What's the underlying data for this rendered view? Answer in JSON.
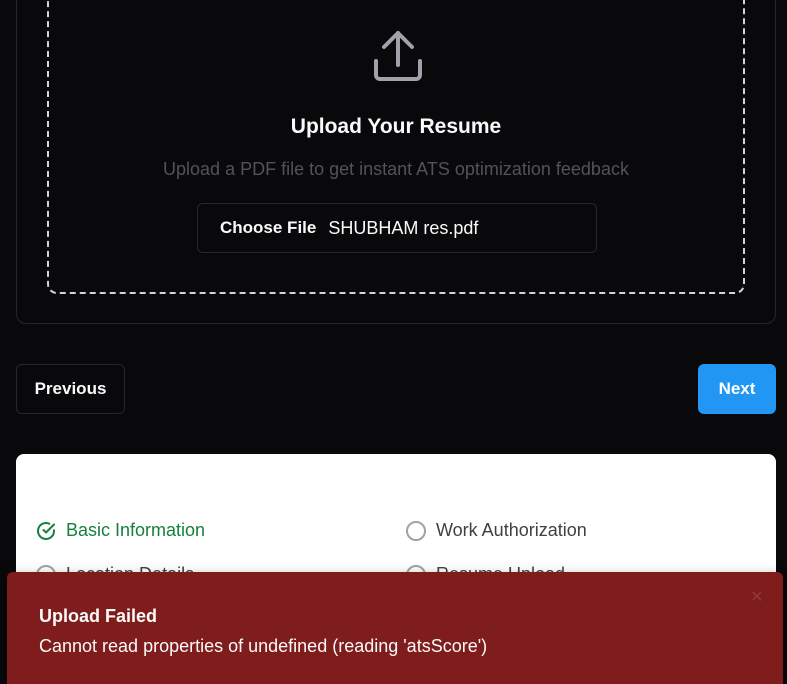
{
  "upload": {
    "title": "Upload Your Resume",
    "subtitle": "Upload a PDF file to get instant ATS optimization feedback",
    "choose_file_label": "Choose File",
    "file_name": "SHUBHAM res.pdf",
    "icon": "upload-icon"
  },
  "nav": {
    "previous_label": "Previous",
    "next_label": "Next",
    "next_color": "#2196f3"
  },
  "steps": [
    {
      "label": "Basic Information",
      "status": "done",
      "icon": "check-circle-icon"
    },
    {
      "label": "Work Authorization",
      "status": "todo",
      "icon": "circle-icon"
    },
    {
      "label": "Location Details",
      "status": "todo",
      "icon": "circle-icon"
    },
    {
      "label": "Resume Upload",
      "status": "todo",
      "icon": "circle-icon"
    }
  ],
  "toast": {
    "title": "Upload Failed",
    "message": "Cannot read properties of undefined (reading 'atsScore')",
    "close_icon": "close-icon",
    "color": "#7f1d1d"
  }
}
